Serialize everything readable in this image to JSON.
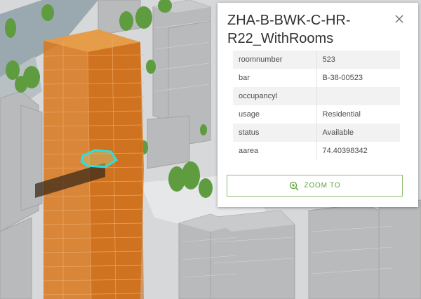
{
  "popup": {
    "title": "ZHA-B-BWK-C-HR-R22_WithRooms",
    "zoom_label": "ZOOM TO",
    "attributes": [
      {
        "field": "roomnumber",
        "value": "523"
      },
      {
        "field": "bar",
        "value": "B-38-00523"
      },
      {
        "field": "occupancyl",
        "value": ""
      },
      {
        "field": "usage",
        "value": "Residential"
      },
      {
        "field": "status",
        "value": "Available"
      },
      {
        "field": "aarea",
        "value": "74.40398342"
      }
    ]
  },
  "icons": {
    "close": "close-icon",
    "zoom": "zoom-in-icon"
  },
  "colors": {
    "accent": "#5aa33c",
    "highlight": "#29e0e0",
    "building_floors": "#d9781c"
  }
}
